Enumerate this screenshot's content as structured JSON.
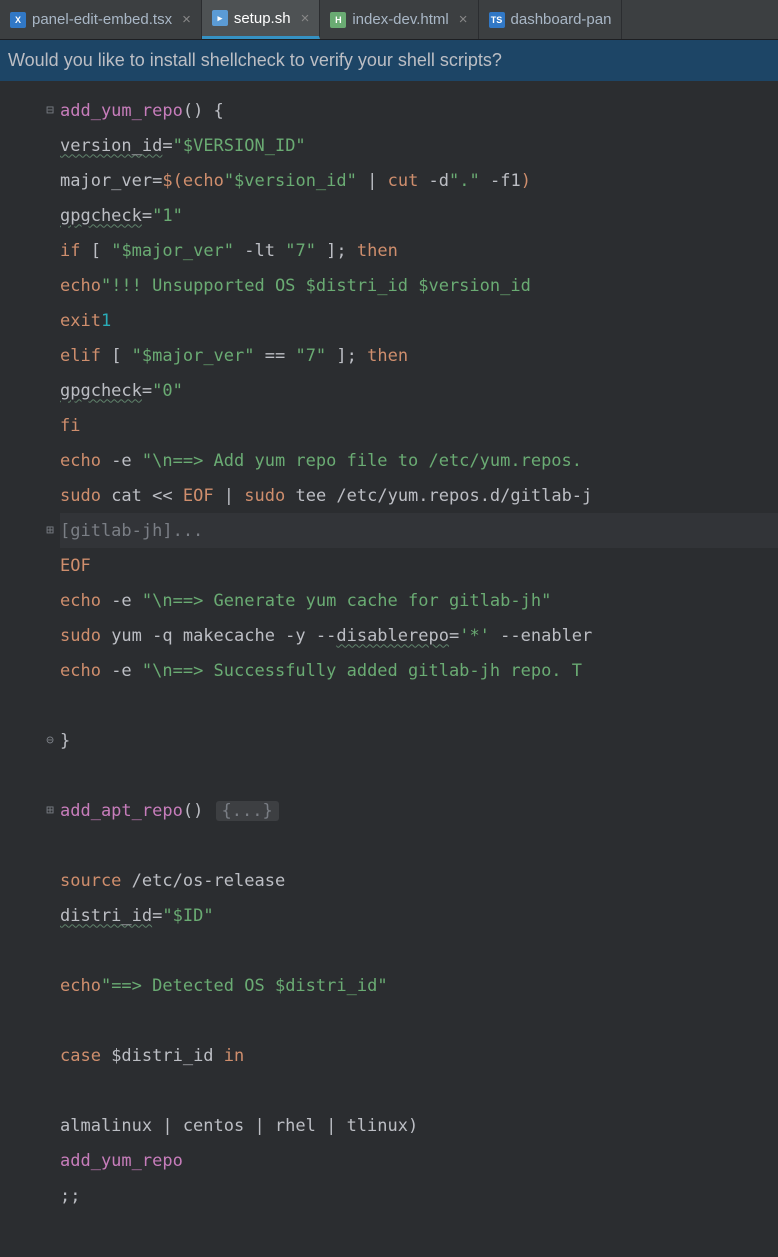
{
  "tabs": [
    {
      "label": "panel-edit-embed.tsx",
      "icon": "tsx",
      "iconText": "X"
    },
    {
      "label": "setup.sh",
      "icon": "sh",
      "iconText": "▸",
      "active": true
    },
    {
      "label": "index-dev.html",
      "icon": "html",
      "iconText": "H"
    },
    {
      "label": "dashboard-pan",
      "icon": "ts",
      "iconText": "TS"
    }
  ],
  "banner": "Would you like to install shellcheck to verify your shell scripts?",
  "code": {
    "l1_fn": "add_yum_repo",
    "l1_rest": "() {",
    "l2_var": "version_id",
    "l2_str": "\"$VERSION_ID\"",
    "l3_var": "major_ver",
    "l3_subopen": "$(",
    "l3_echo": "echo",
    "l3_s1": "\"$version_id\"",
    "l3_pipe": " | ",
    "l3_cut": "cut",
    "l3_dflag": " -d",
    "l3_s2": "\".\"",
    "l3_f1": " -f1",
    "l3_close": ")",
    "l4_var": "gpgcheck",
    "l4_str": "\"1\"",
    "l5_if": "if",
    "l5_b1": " [ ",
    "l5_s1": "\"$major_ver\"",
    "l5_lt": " -lt ",
    "l5_s2": "\"7\"",
    "l5_b2": " ]; ",
    "l5_then": "then",
    "l6_echo": "echo",
    "l6_str": "\"!!! Unsupported OS $distri_id $version_id",
    "l7_exit": "exit",
    "l7_num": "1",
    "l8_elif": "elif",
    "l8_b1": " [ ",
    "l8_s1": "\"$major_ver\"",
    "l8_eq": " == ",
    "l8_s2": "\"7\"",
    "l8_b2": " ]; ",
    "l8_then": "then",
    "l9_var": "gpgcheck",
    "l9_str": "\"0\"",
    "l10_fi": "fi",
    "l11_echo": "echo",
    "l11_flag": " -e ",
    "l11_str": "\"\\n==> Add yum repo file to /etc/yum.repos.",
    "l12_sudo1": "sudo",
    "l12_cat": " cat << ",
    "l12_eof": "EOF",
    "l12_pipe": " | ",
    "l12_sudo2": "sudo",
    "l12_tee": " tee /etc/yum.repos.d/gitlab-j",
    "l13_folded": "[gitlab-jh]...",
    "l14_eof": "EOF",
    "l15_echo": "echo",
    "l15_flag": " -e ",
    "l15_str": "\"\\n==> Generate yum cache for gitlab-jh\"",
    "l16_sudo": "sudo",
    "l16_yum": " yum -q makecache -y --",
    "l16_disable": "disablerepo",
    "l16_eq": "=",
    "l16_s1": "'*'",
    "l16_en": " --enabler",
    "l17_echo": "echo",
    "l17_flag": " -e ",
    "l17_str": "\"\\n==> Successfully added gitlab-jh repo. T",
    "l19_close": "}",
    "l21_fn": "add_apt_repo",
    "l21_paren": "() ",
    "l21_folded": "{...}",
    "l23_source": "source",
    "l23_path": " /etc/os-release",
    "l24_var": "distri_id",
    "l24_str": "\"$ID\"",
    "l26_echo": "echo",
    "l26_s1": "\"==> Detected OS ",
    "l26_var": "$distri_id",
    "l26_s2": "\"",
    "l28_case": "case",
    "l28_var": " $distri_id ",
    "l28_in": "in",
    "l30_pat": "almalinux | centos | rhel | tlinux)",
    "l31_call": "add_yum_repo",
    "l32_semi": ";;"
  }
}
